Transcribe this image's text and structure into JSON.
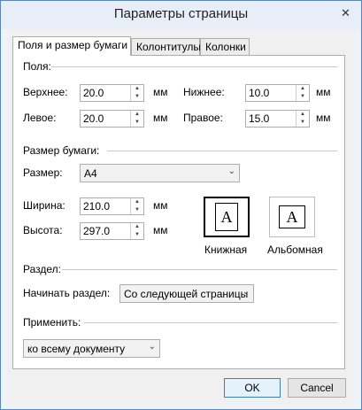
{
  "window": {
    "title": "Параметры страницы",
    "close_glyph": "✕"
  },
  "tabs": [
    {
      "label": "Поля и размер бумаги",
      "active": true
    },
    {
      "label": "Колонтитулы",
      "active": false
    },
    {
      "label": "Колонки",
      "active": false
    }
  ],
  "margins": {
    "group_label": "Поля:",
    "top": {
      "label": "Верхнее:",
      "value": "20.0",
      "unit": "мм"
    },
    "bottom": {
      "label": "Нижнее:",
      "value": "10.0",
      "unit": "мм"
    },
    "left": {
      "label": "Левое:",
      "value": "20.0",
      "unit": "мм"
    },
    "right": {
      "label": "Правое:",
      "value": "15.0",
      "unit": "мм"
    }
  },
  "paper": {
    "group_label": "Размер бумаги:",
    "size_label": "Размер:",
    "size_value": "A4",
    "width": {
      "label": "Ширина:",
      "value": "210.0",
      "unit": "мм"
    },
    "height": {
      "label": "Высота:",
      "value": "297.0",
      "unit": "мм"
    },
    "orientation": {
      "portrait_label": "Книжная",
      "landscape_label": "Альбомная",
      "icon_glyph": "A",
      "selected": "portrait"
    }
  },
  "section": {
    "group_label": "Раздел:",
    "start_label": "Начинать раздел:",
    "start_value": "Со следующей страницы"
  },
  "apply": {
    "group_label": "Применить:",
    "value": "ко всему документу"
  },
  "buttons": {
    "ok": "OK",
    "cancel": "Cancel"
  },
  "spin_up": "▲",
  "spin_down": "▼",
  "chevron": "⌄"
}
